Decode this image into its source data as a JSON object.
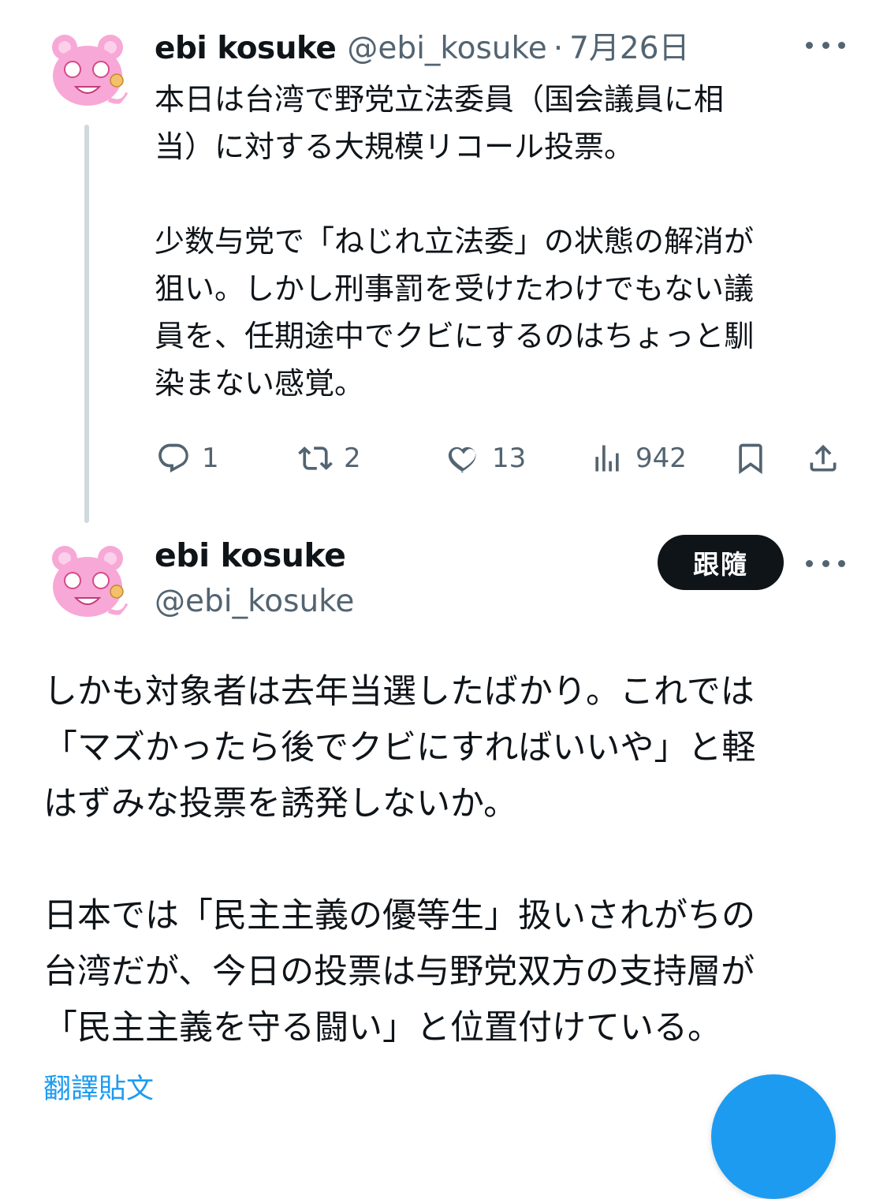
{
  "tweet1": {
    "display_name": "ebi kosuke",
    "handle": "@ebi_kosuke",
    "separator": "·",
    "date": "7月26日",
    "text": "本日は台湾で野党立法委員（国会議員に相\n当）に対する大規模リコール投票。\n\n少数与党で「ねじれ立法委」の状態の解消が\n狙い。しかし刑事罰を受けたわけでもない議\n員を、任期途中でクビにするのはちょっと馴\n染まない感覚。",
    "actions": {
      "replies": "1",
      "retweets": "2",
      "likes": "13",
      "views": "942"
    }
  },
  "tweet2": {
    "display_name": "ebi kosuke",
    "handle": "@ebi_kosuke",
    "follow_label": "跟隨",
    "text": "しかも対象者は去年当選したばかり。これでは\n「マズかったら後でクビにすればいいや」と軽\nはずみな投票を誘発しないか。\n\n日本では「民主主義の優等生」扱いされがちの\n台湾だが、今日の投票は与野党双方の支持層が\n「民主主義を守る闘い」と位置付けている。",
    "translate_label": "翻譯貼文"
  },
  "colors": {
    "text": "#0f1419",
    "secondary": "#536471",
    "accent": "#1d9bf0",
    "thread_line": "#cfd9de",
    "avatar_pink": "#f7a8d6"
  },
  "icons": [
    "more-icon",
    "reply-icon",
    "retweet-icon",
    "like-icon",
    "views-icon",
    "bookmark-icon",
    "share-icon"
  ]
}
